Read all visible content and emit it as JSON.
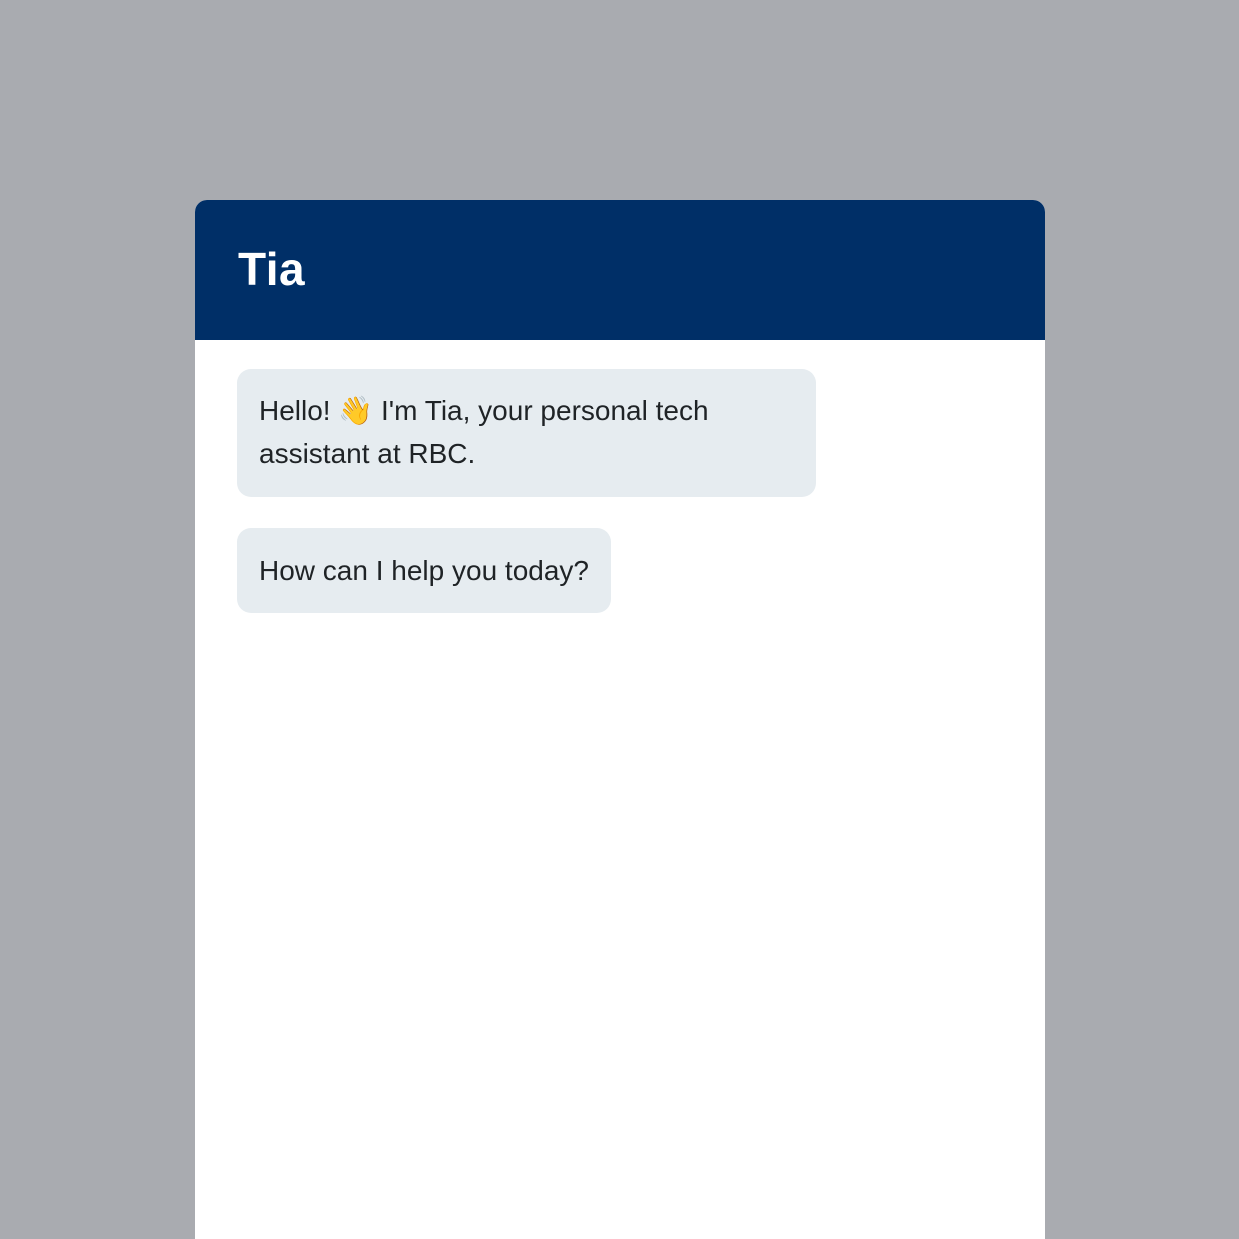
{
  "app": {
    "title": "Tia",
    "header_color": "#002f67",
    "background_color": "#a9abb0",
    "bubble_color": "#e6ecf0"
  },
  "messages": [
    {
      "sender": "bot",
      "text_before_icon": "Hello!",
      "icon": "waving-hand-icon",
      "icon_glyph": "👋",
      "text_after_icon": "I'm Tia, your personal tech assistant at RBC."
    },
    {
      "sender": "bot",
      "text": "How can I help you today?"
    }
  ]
}
